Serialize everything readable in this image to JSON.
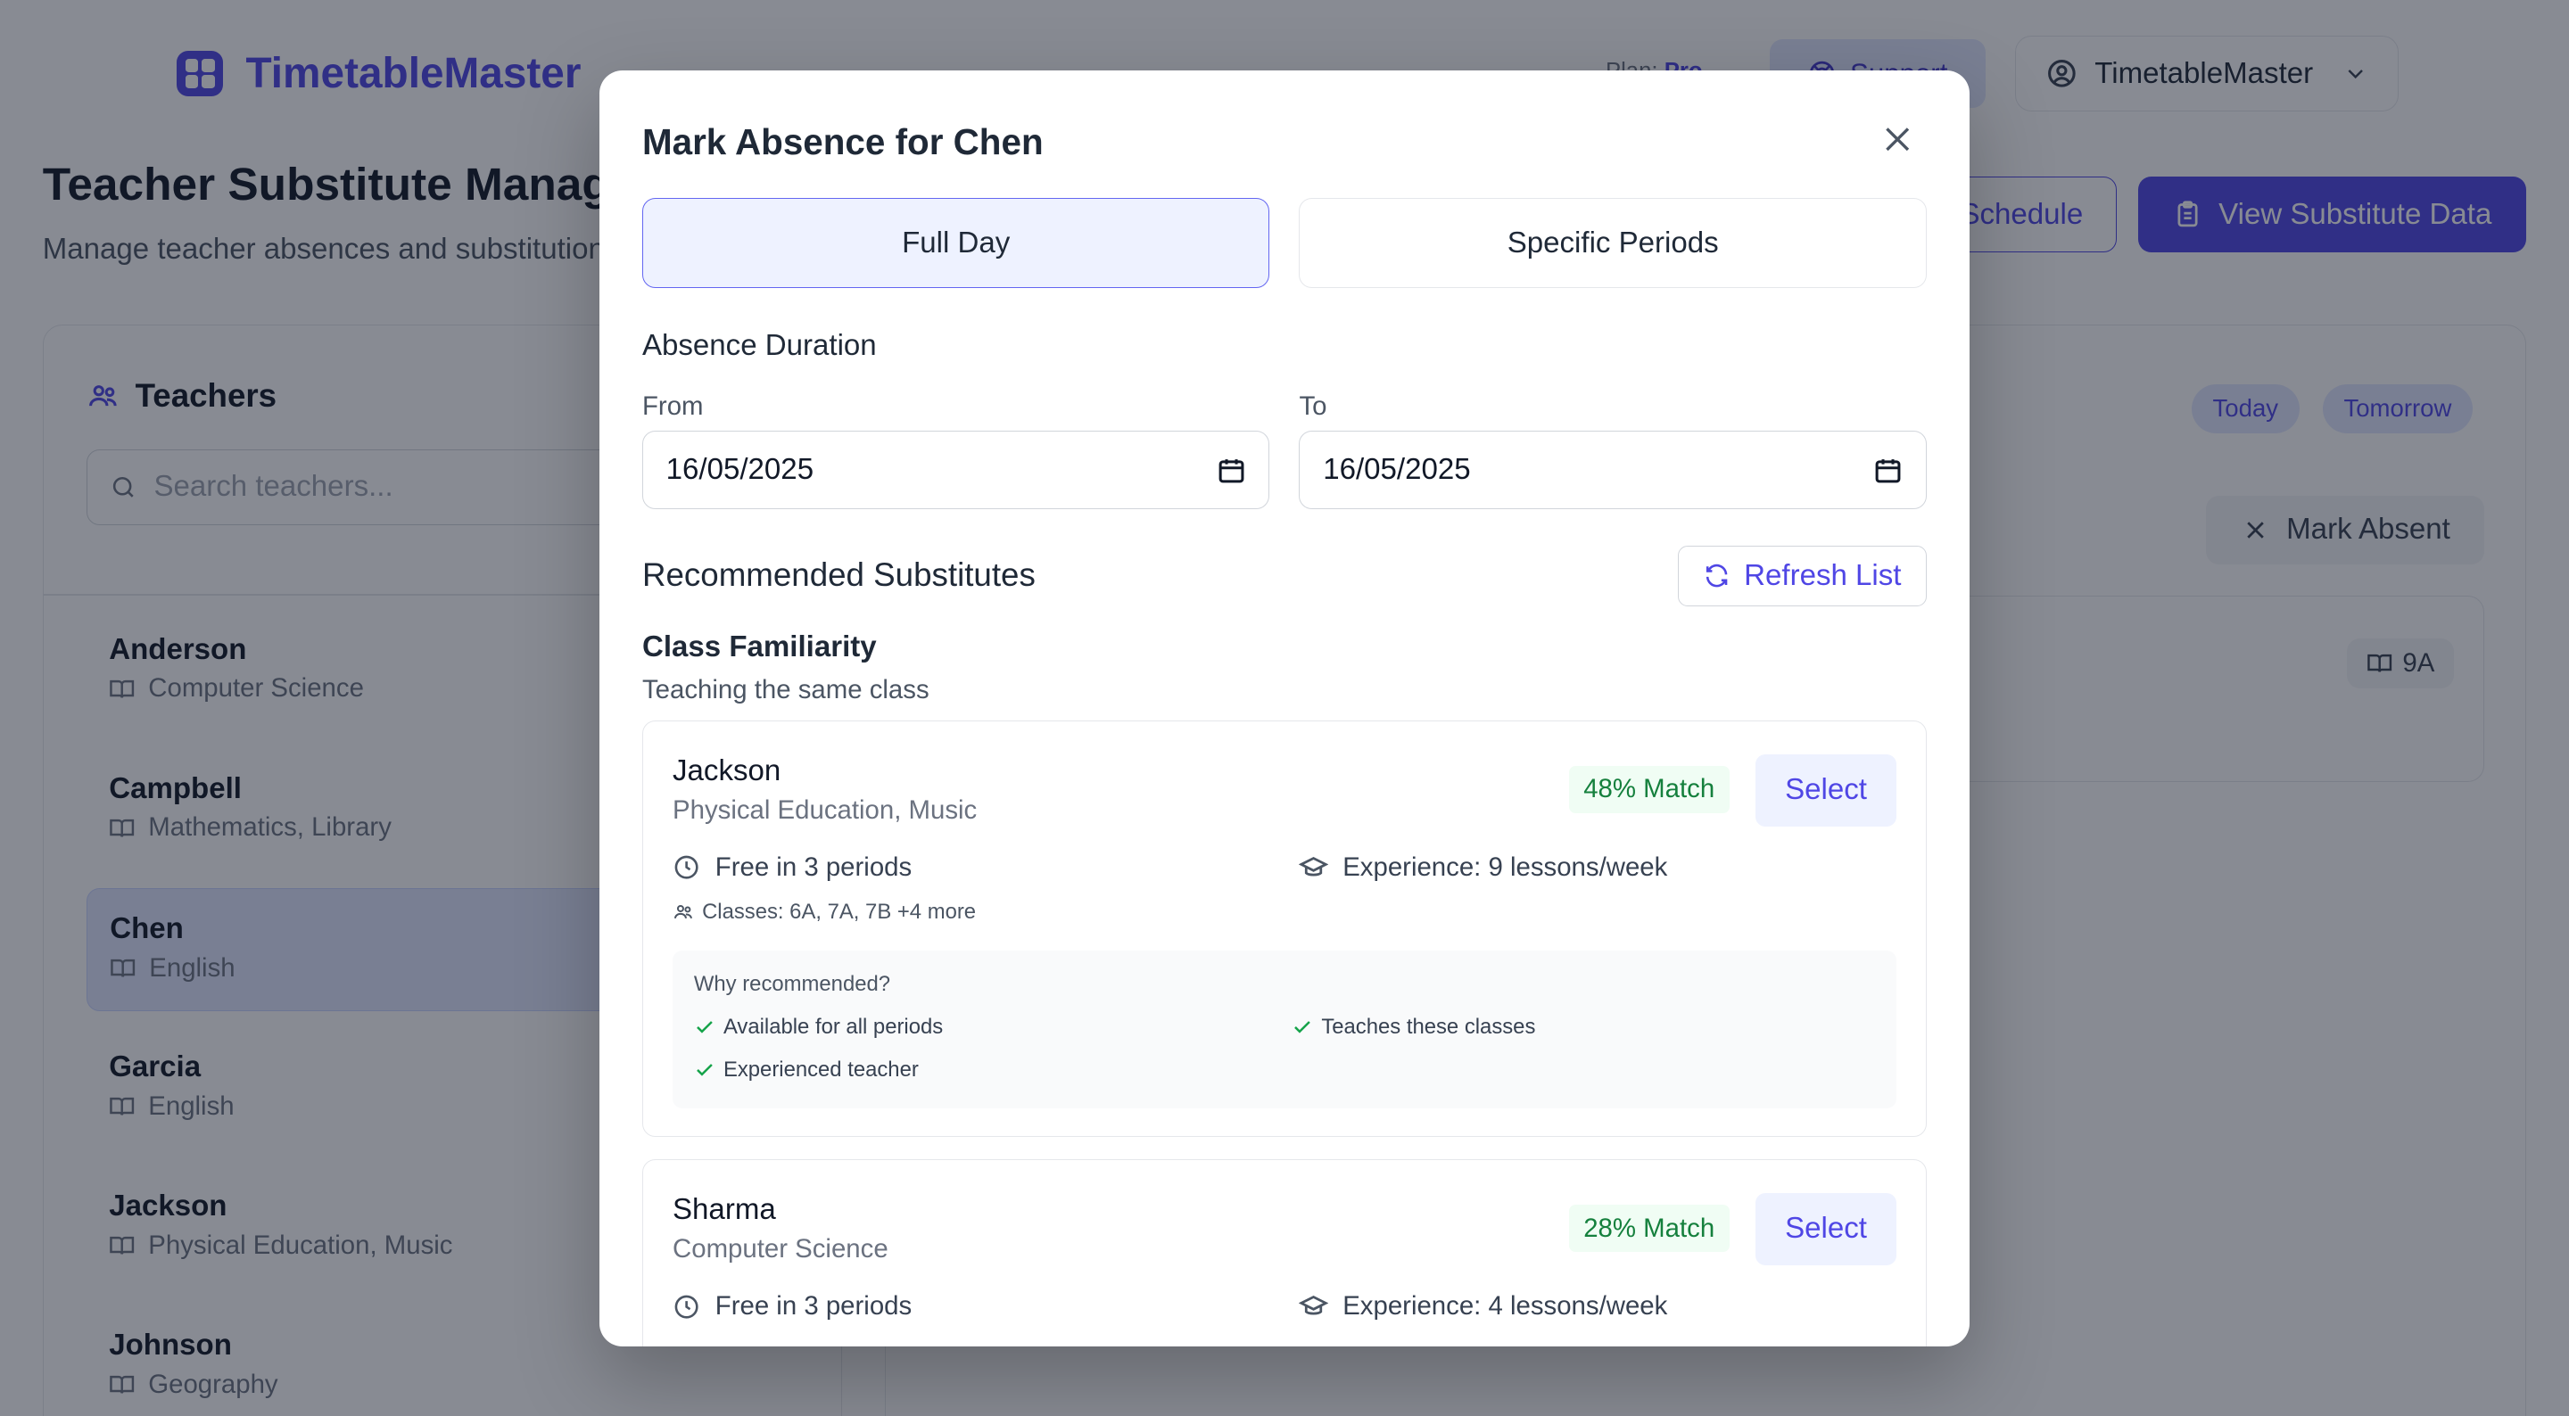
{
  "header": {
    "brand": "TimetableMaster",
    "plan_label": "Plan:",
    "plan_value": "Pro",
    "support_label": "Support",
    "account_label": "TimetableMaster"
  },
  "page": {
    "title": "Teacher Substitute Management",
    "subtitle": "Manage teacher absences and substitutions",
    "schedule_button": "Schedule",
    "view_data_button": "View Substitute Data"
  },
  "teachers_panel": {
    "title": "Teachers",
    "search_placeholder": "Search teachers...",
    "items": [
      {
        "name": "Anderson",
        "subject": "Computer Science"
      },
      {
        "name": "Campbell",
        "subject": "Mathematics, Library"
      },
      {
        "name": "Chen",
        "subject": "English"
      },
      {
        "name": "Garcia",
        "subject": "English"
      },
      {
        "name": "Jackson",
        "subject": "Physical Education, Music"
      },
      {
        "name": "Johnson",
        "subject": "Geography"
      }
    ]
  },
  "detail_panel": {
    "today_chip": "Today",
    "tomorrow_chip": "Tomorrow",
    "mark_absent_label": "Mark Absent",
    "class_chip": "9A"
  },
  "modal": {
    "title": "Mark Absence for Chen",
    "full_day_label": "Full Day",
    "specific_periods_label": "Specific Periods",
    "duration_label": "Absence Duration",
    "from_label": "From",
    "from_value": "16/05/2025",
    "to_label": "To",
    "to_value": "16/05/2025",
    "recommended_title": "Recommended Substitutes",
    "refresh_label": "Refresh List",
    "familiarity_title": "Class Familiarity",
    "familiarity_subtitle": "Teaching the same class",
    "substitutes": [
      {
        "name": "Jackson",
        "subject": "Physical Education, Music",
        "match": "48% Match",
        "select_label": "Select",
        "free": "Free in 3 periods",
        "experience": "Experience: 9 lessons/week",
        "classes": "Classes: 6A, 7A, 7B +4 more",
        "why_title": "Why recommended?",
        "reasons": [
          "Available for all periods",
          "Teaches these classes",
          "Experienced teacher"
        ]
      },
      {
        "name": "Sharma",
        "subject": "Computer Science",
        "match": "28% Match",
        "select_label": "Select",
        "free": "Free in 3 periods",
        "experience": "Experience: 4 lessons/week"
      }
    ]
  },
  "colors": {
    "accent": "#4f46e5",
    "accent_light": "#eef2ff",
    "match_green": "#15803d",
    "overlay": "rgba(17,24,39,0.5)"
  }
}
